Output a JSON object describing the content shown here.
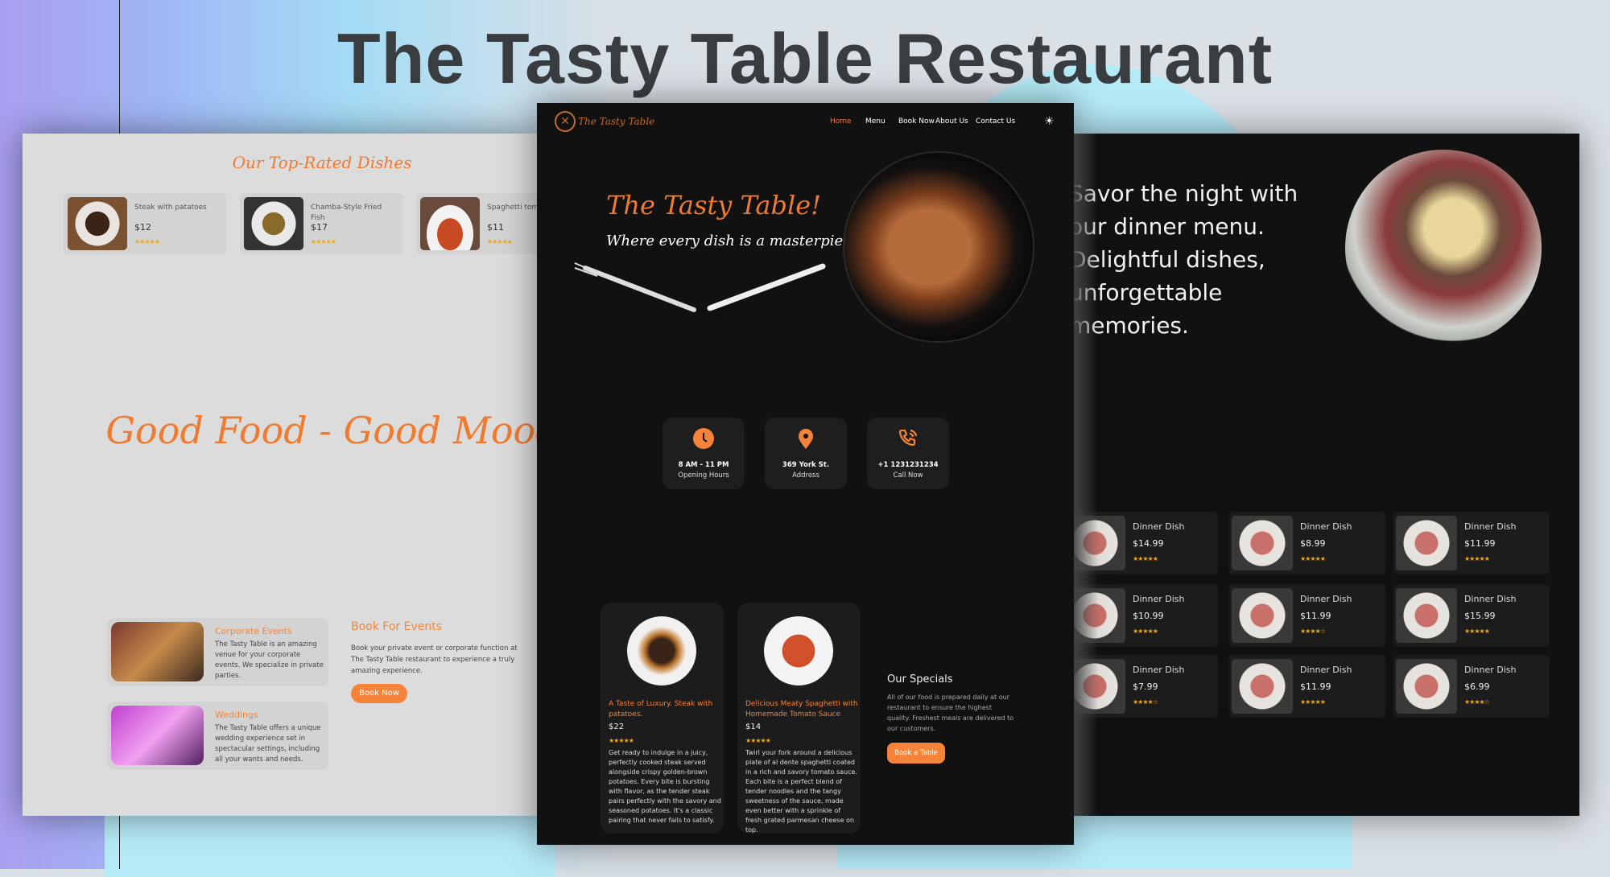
{
  "title": "The Tasty Table Restaurant",
  "left": {
    "section_title": "Our Top-Rated Dishes",
    "dishes": [
      {
        "name": "Steak with patatoes",
        "price": "$12",
        "stars": "★★★★★"
      },
      {
        "name": "Chamba-Style Fried Fish",
        "price": "$17",
        "stars": "★★★★★"
      },
      {
        "name": "Spaghetti tomato",
        "price": "$11",
        "stars": "★★★★★"
      }
    ],
    "slogan": "Good Food - Good Mood",
    "events": [
      {
        "title": "Corporate Events",
        "text": "The Tasty Table is an amazing venue for your corporate events. We specialize in private parties."
      },
      {
        "title": "Weddings",
        "text": "The Tasty Table offers a unique wedding experience set in spectacular settings, including all your wants and needs."
      }
    ],
    "book_title": "Book For Events",
    "book_text": "Book your private event or corporate function at The Tasty Table restaurant to experience a truly amazing experience.",
    "book_button": "Book Now"
  },
  "center": {
    "logo": "The Tasty Table",
    "nav": [
      "Home",
      "Menu",
      "Book Now",
      "About Us",
      "Contact Us"
    ],
    "active_nav": "Home",
    "theme_icon": "sun-icon",
    "hero_title": "The Tasty Table!",
    "hero_subtitle": "Where every dish is a masterpiece.",
    "info": [
      {
        "icon": "clock-icon",
        "value": "8 AM - 11 PM",
        "label": "Opening Hours"
      },
      {
        "icon": "location-pin-icon",
        "value": "369 York St.",
        "label": "Address"
      },
      {
        "icon": "phone-icon",
        "value": "+1 1231231234",
        "label": "Call Now"
      }
    ],
    "specials": [
      {
        "title": "A Taste of Luxury. Steak with patatoes.",
        "price": "$22",
        "stars": "★★★★★",
        "text": "Get ready to indulge in a juicy, perfectly cooked steak served alongside crispy golden-brown potatoes. Every bite is bursting with flavor, as the tender steak pairs perfectly with the savory and seasoned potatoes. It's a classic pairing that never fails to satisfy."
      },
      {
        "title": "Delicious Meaty Spaghetti with Homemade Tomato Sauce",
        "price": "$14",
        "stars": "★★★★★",
        "text": "Twirl your fork around a delicious plate of al dente spaghetti coated in a rich and savory tomato sauce. Each bite is a perfect blend of tender noodles and the tangy sweetness of the sauce, made even better with a sprinkle of fresh grated parmesan cheese on top."
      }
    ],
    "specials_title": "Our Specials",
    "specials_text": "All of our food is prepared daily at our restaurant to ensure the highest quality. Freshest meals are delivered to our customers.",
    "specials_button": "Book a Table"
  },
  "right": {
    "intro": "Savor the night with our dinner menu. Delightful dishes, unforgettable memories.",
    "dishes": [
      {
        "name": "Dinner Dish",
        "price": "$14.99",
        "stars": "★★★★★"
      },
      {
        "name": "Dinner Dish",
        "price": "$8.99",
        "stars": "★★★★★"
      },
      {
        "name": "Dinner Dish",
        "price": "$11.99",
        "stars": "★★★★★"
      },
      {
        "name": "Dinner Dish",
        "price": "$10.99",
        "stars": "★★★★★"
      },
      {
        "name": "Dinner Dish",
        "price": "$11.99",
        "stars": "★★★★☆"
      },
      {
        "name": "Dinner Dish",
        "price": "$15.99",
        "stars": "★★★★★"
      },
      {
        "name": "Dinner Dish",
        "price": "$7.99",
        "stars": "★★★★☆"
      },
      {
        "name": "Dinner Dish",
        "price": "$11.99",
        "stars": "★★★★★"
      },
      {
        "name": "Dinner Dish",
        "price": "$6.99",
        "stars": "★★★★☆"
      }
    ]
  },
  "colors": {
    "accent": "#f5843a",
    "star": "#f6a800",
    "dark_bg": "#111111",
    "light_bg": "#dcdcdc"
  }
}
